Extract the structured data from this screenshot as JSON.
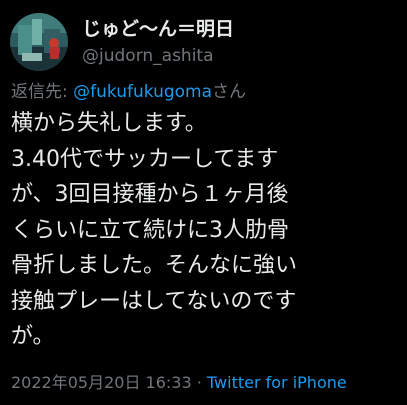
{
  "user": {
    "display_name": "じゅど〜ん＝明日",
    "handle": "@judorn_ashita"
  },
  "reply": {
    "prefix": "返信先: ",
    "mention": "@fukufukugoma",
    "suffix": "さん"
  },
  "tweet": {
    "lines": [
      "横から失礼します。",
      "3.40代でサッカーしてます",
      "が、3回目接種から１ヶ月後",
      "くらいに立て続けに3人肋骨",
      "骨折しました。そんなに強い",
      "接触プレーはしてないのです",
      "が。"
    ]
  },
  "meta": {
    "timestamp": "2022年05月20日 16:33",
    "separator": " · ",
    "source": "Twitter for iPhone"
  },
  "colors": {
    "background": "#000000",
    "text": "#e7e9ea",
    "muted": "#71767b",
    "link": "#1d9bf0"
  },
  "icons": {
    "avatar": "avatar-image"
  }
}
